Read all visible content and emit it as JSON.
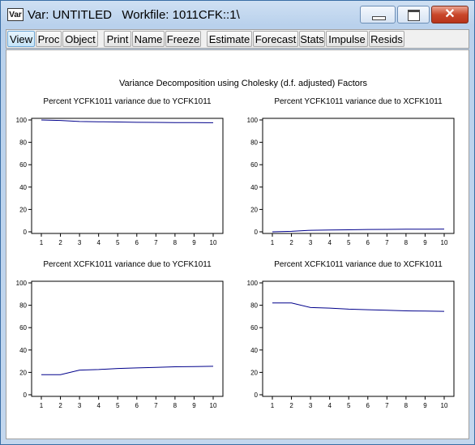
{
  "window": {
    "icon_label": "Var",
    "title": "Var: UNTITLED   Workfile: 1011CFK::1\\",
    "close_glyph": "✕"
  },
  "toolbar": {
    "buttons": [
      "View",
      "Proc",
      "Object",
      "Print",
      "Name",
      "Freeze",
      "Estimate",
      "Forecast",
      "Stats",
      "Impulse",
      "Resids"
    ]
  },
  "figure": {
    "title": "Variance Decomposition using Cholesky (d.f. adjusted) Factors"
  },
  "colors": {
    "line": "#00008b"
  },
  "chart_data": [
    {
      "type": "line",
      "title": "Percent YCFK1011 variance due to YCFK1011",
      "x": [
        1,
        2,
        3,
        4,
        5,
        6,
        7,
        8,
        9,
        10
      ],
      "ylim": [
        0,
        100
      ],
      "yticks": [
        0,
        20,
        40,
        60,
        80,
        100
      ],
      "series": [
        {
          "values": [
            100,
            99.6,
            98.6,
            98.4,
            98.2,
            97.9,
            97.8,
            97.7,
            97.6,
            97.5
          ]
        }
      ]
    },
    {
      "type": "line",
      "title": "Percent YCFK1011 variance due to XCFK1011",
      "x": [
        1,
        2,
        3,
        4,
        5,
        6,
        7,
        8,
        9,
        10
      ],
      "ylim": [
        0,
        100
      ],
      "yticks": [
        0,
        20,
        40,
        60,
        80,
        100
      ],
      "series": [
        {
          "values": [
            0,
            0.4,
            1.4,
            1.6,
            1.8,
            2.1,
            2.2,
            2.3,
            2.4,
            2.5
          ]
        }
      ]
    },
    {
      "type": "line",
      "title": "Percent XCFK1011 variance due to YCFK1011",
      "x": [
        1,
        2,
        3,
        4,
        5,
        6,
        7,
        8,
        9,
        10
      ],
      "ylim": [
        0,
        100
      ],
      "yticks": [
        0,
        20,
        40,
        60,
        80,
        100
      ],
      "series": [
        {
          "values": [
            18,
            18,
            22,
            22.5,
            23.5,
            24,
            24.5,
            25,
            25.2,
            25.4
          ]
        }
      ]
    },
    {
      "type": "line",
      "title": "Percent XCFK1011 variance due to XCFK1011",
      "x": [
        1,
        2,
        3,
        4,
        5,
        6,
        7,
        8,
        9,
        10
      ],
      "ylim": [
        0,
        100
      ],
      "yticks": [
        0,
        20,
        40,
        60,
        80,
        100
      ],
      "series": [
        {
          "values": [
            82,
            82,
            78,
            77.5,
            76.5,
            76,
            75.5,
            75,
            74.8,
            74.6
          ]
        }
      ]
    }
  ]
}
